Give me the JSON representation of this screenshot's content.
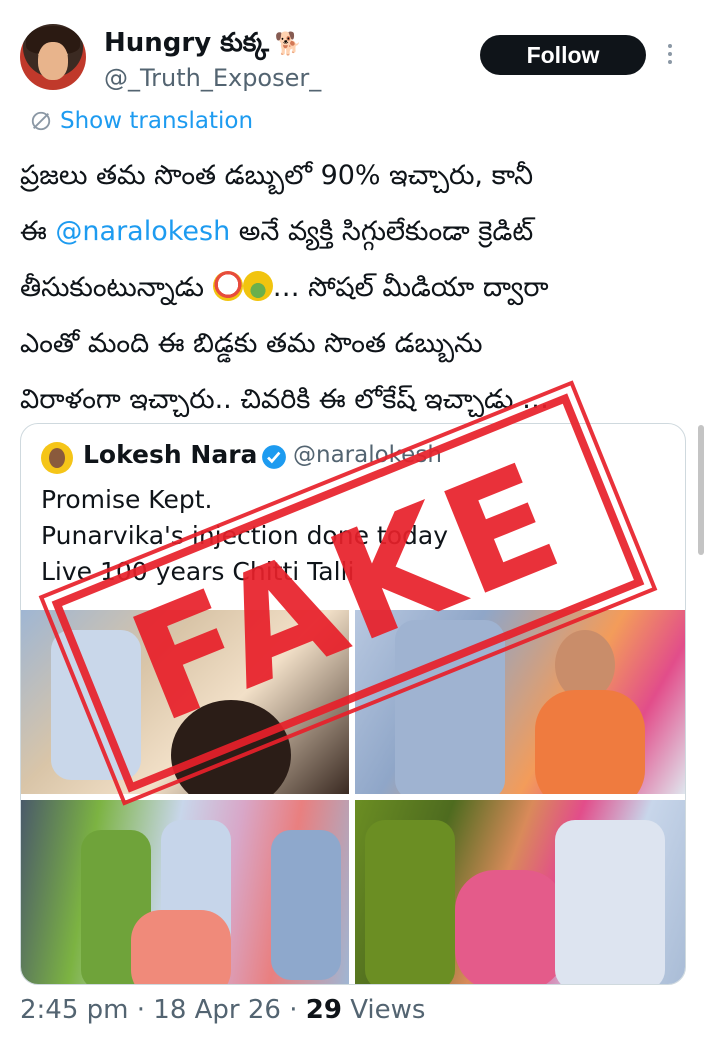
{
  "author": {
    "display_name": "Hungry కుక్క",
    "emoji": "🐕",
    "handle": "@_Truth_Exposer_"
  },
  "follow_button": "Follow",
  "show_translation": "Show translation",
  "tweet": {
    "line1": "ప్రజలు తమ సొంత డబ్బులో 90% ఇచ్చారు, కానీ",
    "line2_prefix": "ఈ ",
    "line2_mention": "@naralokesh",
    "line2_suffix": " అనే వ్యక్తి సిగ్గులేకుండా క్రెడిట్",
    "line3_prefix": "తీసుకుంటున్నాడు ",
    "line3_suffix": "… సోషల్ మీడియా ద్వారా",
    "line4": "ఎంతో మంది ఈ బిడ్డకు తమ సొంత డబ్బును",
    "line5": "విరాళంగా ఇచ్చారు.. చివరికి ఈ లోకేష్ ఇచ్చాడు …"
  },
  "quote": {
    "name": "Lokesh Nara",
    "handle": "@naralokesh",
    "lines": [
      "Promise Kept.",
      "Punarvika's injection done today",
      "Live 100 years Chitti Talli"
    ]
  },
  "stamp_text": "FAKE",
  "footer": {
    "time": "2:45 pm",
    "date": "18 Apr 26",
    "views_count": "29",
    "views_label": "Views"
  },
  "colors": {
    "link": "#1d9bf0",
    "stamp": "#e8202a",
    "text": "#0f1419",
    "secondary": "#536471"
  }
}
